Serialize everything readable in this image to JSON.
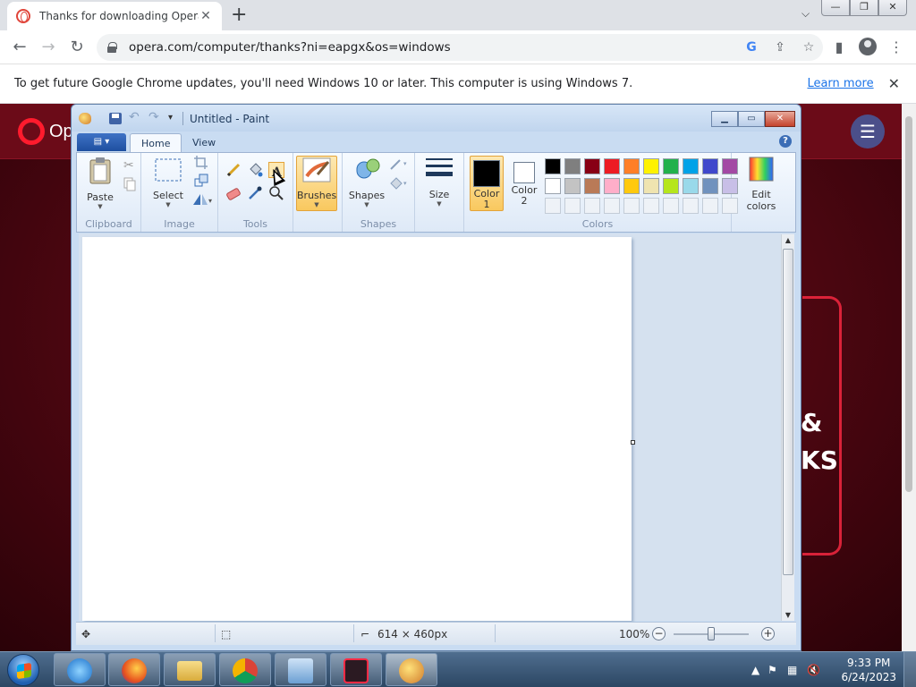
{
  "chrome": {
    "tab_title": "Thanks for downloading Opera",
    "tab_close": "✕",
    "new_tab": "+",
    "url": "opera.com/computer/thanks?ni=eapgx&os=windows",
    "window_controls": [
      "—",
      "❐",
      "✕"
    ]
  },
  "infobar": {
    "message": "To get future Google Chrome updates, you'll need Windows 10 or later. This computer is using Windows 7.",
    "link": "Learn more",
    "close": "✕"
  },
  "opera_page": {
    "logo_text": "Op",
    "heading_fragment_1": "&",
    "heading_fragment_2": "KS"
  },
  "paint": {
    "title": "Untitled - Paint",
    "tabs": [
      "Home",
      "View"
    ],
    "groups": {
      "clipboard": "Clipboard",
      "image": "Image",
      "tools": "Tools",
      "shapes": "Shapes",
      "colors": "Colors"
    },
    "buttons": {
      "paste": "Paste",
      "select": "Select",
      "brushes": "Brushes",
      "shapes": "Shapes",
      "size": "Size",
      "color1_line1": "Color",
      "color1_line2": "1",
      "color2_line1": "Color",
      "color2_line2": "2",
      "edit_colors_line1": "Edit",
      "edit_colors_line2": "colors"
    },
    "palette_row1": [
      "#000000",
      "#7f7f7f",
      "#880015",
      "#ed1c24",
      "#ff7f27",
      "#fff200",
      "#22b14c",
      "#00a2e8",
      "#3f48cc",
      "#a349a4"
    ],
    "palette_row2": [
      "#ffffff",
      "#c3c3c3",
      "#b97a57",
      "#ffaec9",
      "#ffc90e",
      "#efe4b0",
      "#b5e61d",
      "#99d9ea",
      "#7092be",
      "#c8bfe7"
    ],
    "color1": "#000000",
    "color2": "#ffffff",
    "status": {
      "dimensions": "614 × 460px",
      "zoom": "100%"
    }
  },
  "taskbar": {
    "time": "9:33 PM",
    "date": "6/24/2023"
  }
}
